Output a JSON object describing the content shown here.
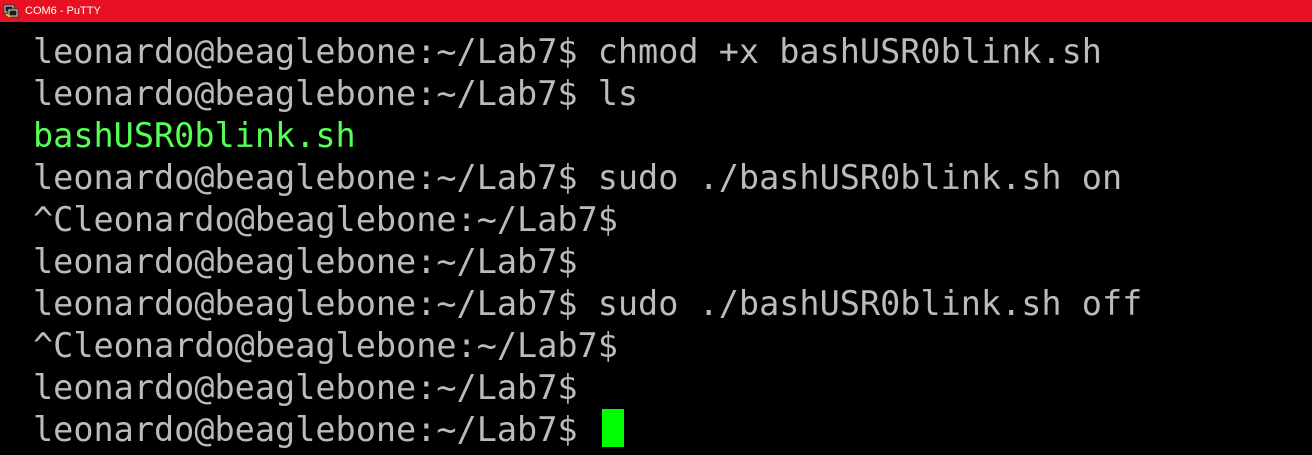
{
  "window": {
    "title": "COM6 - PuTTY",
    "icon": "putty-terminal-icon",
    "titlebar_color": "#e81123"
  },
  "terminal": {
    "background": "#000000",
    "foreground": "#bbbbbb",
    "executable_color": "#55ff55",
    "cursor_color": "#00ff00",
    "lines": [
      {
        "text": "leonardo@beaglebone:~/Lab7$ chmod +x bashUSR0blink.sh",
        "kind": "command"
      },
      {
        "text": "leonardo@beaglebone:~/Lab7$ ls",
        "kind": "command"
      },
      {
        "text": "bashUSR0blink.sh",
        "kind": "executable"
      },
      {
        "text": "leonardo@beaglebone:~/Lab7$ sudo ./bashUSR0blink.sh on",
        "kind": "command"
      },
      {
        "text": "^Cleonardo@beaglebone:~/Lab7$",
        "kind": "command"
      },
      {
        "text": "leonardo@beaglebone:~/Lab7$",
        "kind": "command"
      },
      {
        "text": "leonardo@beaglebone:~/Lab7$ sudo ./bashUSR0blink.sh off",
        "kind": "command"
      },
      {
        "text": "^Cleonardo@beaglebone:~/Lab7$",
        "kind": "command"
      },
      {
        "text": "leonardo@beaglebone:~/Lab7$",
        "kind": "command"
      },
      {
        "text": "leonardo@beaglebone:~/Lab7$ ",
        "kind": "prompt"
      }
    ]
  }
}
